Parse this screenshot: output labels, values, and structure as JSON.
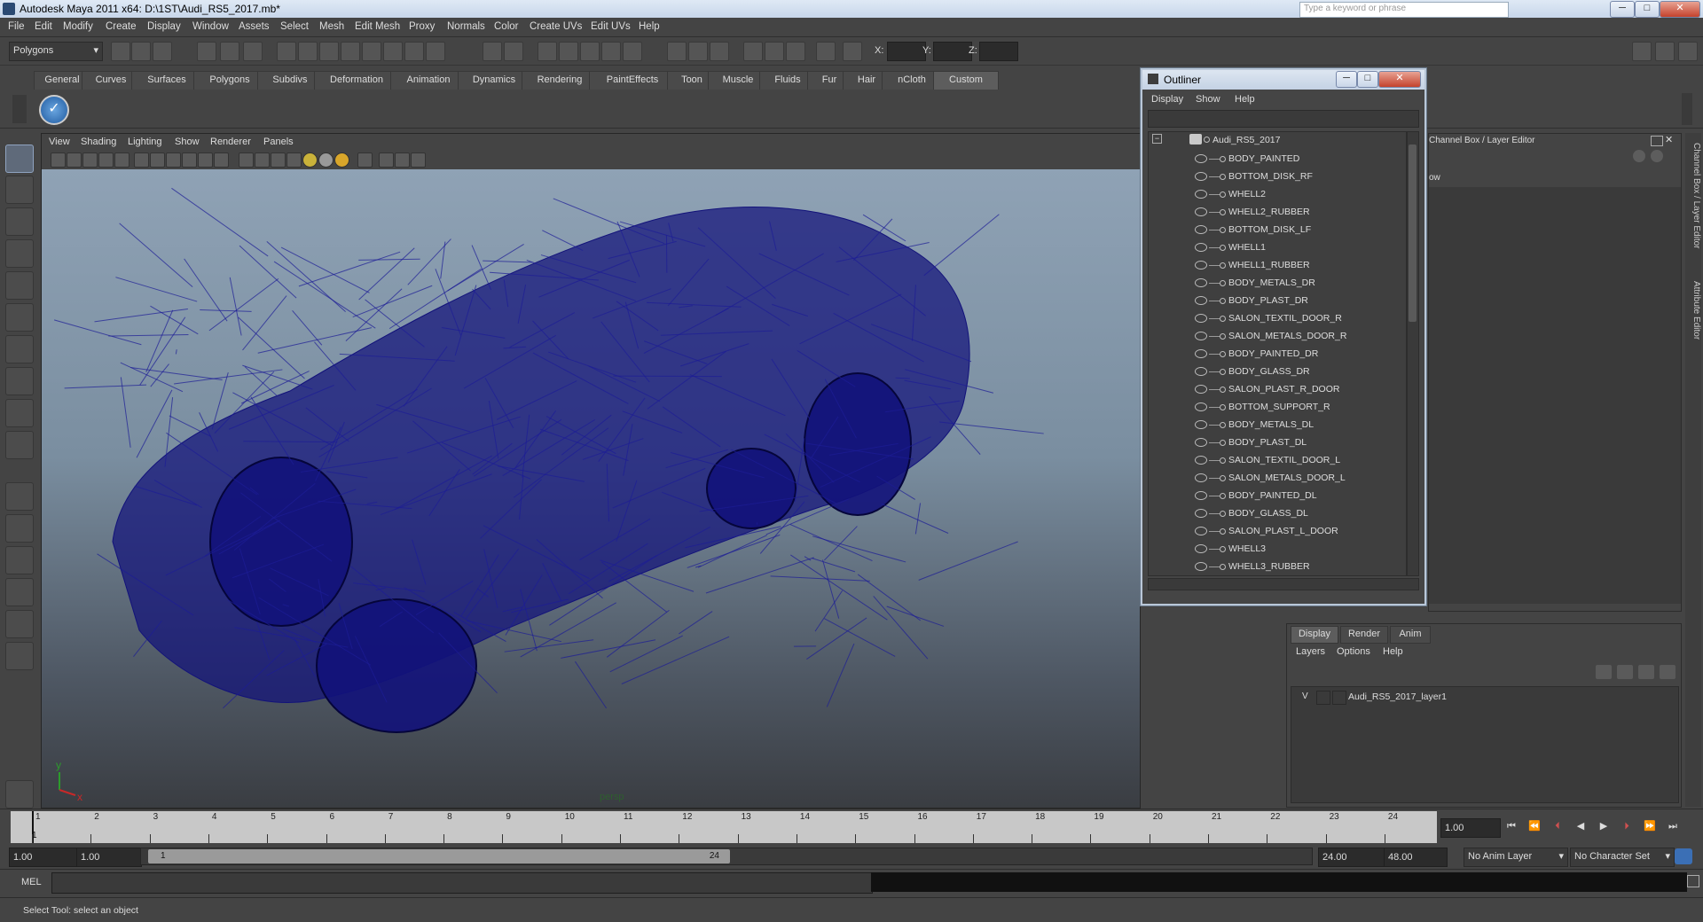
{
  "window": {
    "title": "Autodesk Maya 2011 x64: D:\\1ST\\Audi_RS5_2017.mb*",
    "search_placeholder": "Type a keyword or phrase",
    "minimize_label": "─",
    "maximize_label": "□",
    "close_label": "✕"
  },
  "menubar": [
    "File",
    "Edit",
    "Modify",
    "Create",
    "Display",
    "Window",
    "Assets",
    "Select",
    "Mesh",
    "Edit Mesh",
    "Proxy",
    "Normals",
    "Color",
    "Create UVs",
    "Edit UVs",
    "Help"
  ],
  "statusline": {
    "menu_set": "Polygons",
    "x_label": "X:",
    "y_label": "Y:",
    "z_label": "Z:"
  },
  "shelf": {
    "tabs": [
      "General",
      "Curves",
      "Surfaces",
      "Polygons",
      "Subdivs",
      "Deformation",
      "Animation",
      "Dynamics",
      "Rendering",
      "PaintEffects",
      "Toon",
      "Muscle",
      "Fluids",
      "Fur",
      "Hair",
      "nCloth",
      "Custom"
    ],
    "active_tab": "Custom"
  },
  "viewport": {
    "menus": [
      "View",
      "Shading",
      "Lighting",
      "Show",
      "Renderer",
      "Panels"
    ],
    "camera_label": "persp",
    "wire_color": "#12127a",
    "axis_y": "y",
    "axis_x": "x"
  },
  "outliner": {
    "title": "Outliner",
    "menus": [
      "Display",
      "Show",
      "Help"
    ],
    "root": "Audi_RS5_2017",
    "items": [
      "BODY_PAINTED",
      "BOTTOM_DISK_RF",
      "WHELL2",
      "WHELL2_RUBBER",
      "BOTTOM_DISK_LF",
      "WHELL1",
      "WHELL1_RUBBER",
      "BODY_METALS_DR",
      "BODY_PLAST_DR",
      "SALON_TEXTIL_DOOR_R",
      "SALON_METALS_DOOR_R",
      "BODY_PAINTED_DR",
      "BODY_GLASS_DR",
      "SALON_PLAST_R_DOOR",
      "BOTTOM_SUPPORT_R",
      "BODY_METALS_DL",
      "BODY_PLAST_DL",
      "SALON_TEXTIL_DOOR_L",
      "SALON_METALS_DOOR_L",
      "BODY_PAINTED_DL",
      "BODY_GLASS_DL",
      "SALON_PLAST_L_DOOR",
      "WHELL3",
      "WHELL3_RUBBER"
    ]
  },
  "channel_box": {
    "title": "Channel Box / Layer Editor",
    "partial_label": "ow"
  },
  "side_tabs": [
    "Channel Box / Layer Editor",
    "Attribute Editor"
  ],
  "layer_editor": {
    "tabs": [
      "Display",
      "Render",
      "Anim"
    ],
    "active_tab": "Display",
    "menus": [
      "Layers",
      "Options",
      "Help"
    ],
    "layer": {
      "visible": "V",
      "name": "Audi_RS5_2017_layer1"
    }
  },
  "time_slider": {
    "ticks": [
      "1",
      "2",
      "3",
      "4",
      "5",
      "6",
      "7",
      "8",
      "9",
      "10",
      "11",
      "12",
      "13",
      "14",
      "15",
      "16",
      "17",
      "18",
      "19",
      "20",
      "21",
      "22",
      "23",
      "24"
    ],
    "current_frame_label": "1",
    "current_frame_field": "1.00"
  },
  "range_slider": {
    "start_time": "1.00",
    "playback_start": "1.00",
    "range_start_label": "1",
    "range_end_label": "24",
    "playback_end": "24.00",
    "end_time": "48.00",
    "anim_layer": "No Anim Layer",
    "character_set": "No Character Set"
  },
  "command_line": {
    "label": "MEL"
  },
  "help_line": {
    "text": "Select Tool: select an object"
  }
}
